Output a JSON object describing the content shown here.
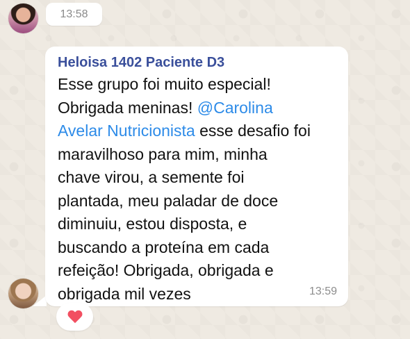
{
  "header": {
    "time": "13:58"
  },
  "message": {
    "sender": "Heloisa 1402 Paciente D3",
    "lines": [
      "Esse grupo foi muito especial!",
      "Obrigada meninas!",
      "@Carolina",
      "Avelar Nutricionista",
      " esse desafio foi",
      "maravilhoso para mim, minha",
      "chave virou, a semente foi",
      "plantada, meu paladar de doce",
      "diminuiu, estou disposta, e",
      "buscando a proteína em cada",
      "refeição! Obrigada, obrigada e",
      "obrigada mil vezes"
    ],
    "time": "13:59"
  },
  "reaction": {
    "icon": "heart-icon"
  },
  "colors": {
    "background": "#efeae2",
    "bubble": "#ffffff",
    "sender": "#3a4f9b",
    "mention": "#2d8be8",
    "heart": "#f24f61"
  }
}
